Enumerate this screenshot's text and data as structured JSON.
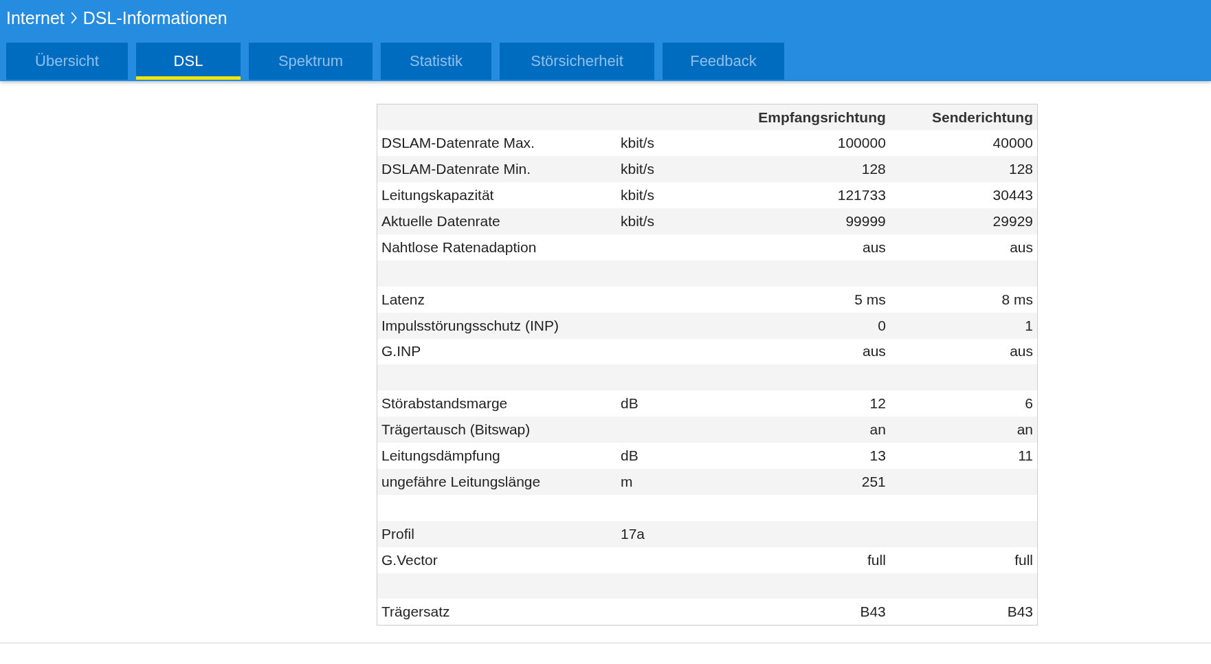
{
  "header": {
    "breadcrumb": [
      {
        "label": "Internet"
      },
      {
        "label": "DSL-Informationen"
      }
    ]
  },
  "tabs": [
    {
      "label": "Übersicht",
      "selected": false
    },
    {
      "label": "DSL",
      "selected": true
    },
    {
      "label": "Spektrum",
      "selected": false
    },
    {
      "label": "Statistik",
      "selected": false
    },
    {
      "label": "Störsicherheit",
      "selected": false
    },
    {
      "label": "Feedback",
      "selected": false
    }
  ],
  "table": {
    "columns": [
      "Empfangsrichtung",
      "Senderichtung"
    ],
    "rows": [
      {
        "kind": "data",
        "label": "DSLAM-Datenrate Max.",
        "unit": "kbit/s",
        "down": "100000",
        "up": "40000"
      },
      {
        "kind": "data",
        "label": "DSLAM-Datenrate Min.",
        "unit": "kbit/s",
        "down": "128",
        "up": "128"
      },
      {
        "kind": "data",
        "label": "Leitungskapazität",
        "unit": "kbit/s",
        "down": "121733",
        "up": "30443"
      },
      {
        "kind": "data",
        "label": "Aktuelle Datenrate",
        "unit": "kbit/s",
        "down": "99999",
        "up": "29929"
      },
      {
        "kind": "data",
        "label": "Nahtlose Ratenadaption",
        "down": "aus",
        "up": "aus"
      },
      {
        "kind": "spacer"
      },
      {
        "kind": "data",
        "label": "Latenz",
        "down": "5 ms",
        "up": "8 ms"
      },
      {
        "kind": "data",
        "label": "Impulsstörungsschutz (INP)",
        "down": "0",
        "up": "1"
      },
      {
        "kind": "data",
        "label": "G.INP",
        "down": "aus",
        "up": "aus"
      },
      {
        "kind": "spacer"
      },
      {
        "kind": "data",
        "label": "Störabstandsmarge",
        "unit": "dB",
        "down": "12",
        "up": "6"
      },
      {
        "kind": "data",
        "label": "Trägertausch (Bitswap)",
        "down": "an",
        "up": "an"
      },
      {
        "kind": "data",
        "label": "Leitungsdämpfung",
        "unit": "dB",
        "down": "13",
        "up": "11"
      },
      {
        "kind": "data",
        "label": "ungefähre Leitungslänge",
        "unit": "m",
        "down": "251"
      },
      {
        "kind": "spacer"
      },
      {
        "kind": "data",
        "label": "Profil",
        "unit": "17a"
      },
      {
        "kind": "data",
        "label": "G.Vector",
        "down": "full",
        "up": "full"
      },
      {
        "kind": "spacer"
      },
      {
        "kind": "data",
        "label": "Trägersatz",
        "down": "B43",
        "up": "B43"
      }
    ]
  }
}
